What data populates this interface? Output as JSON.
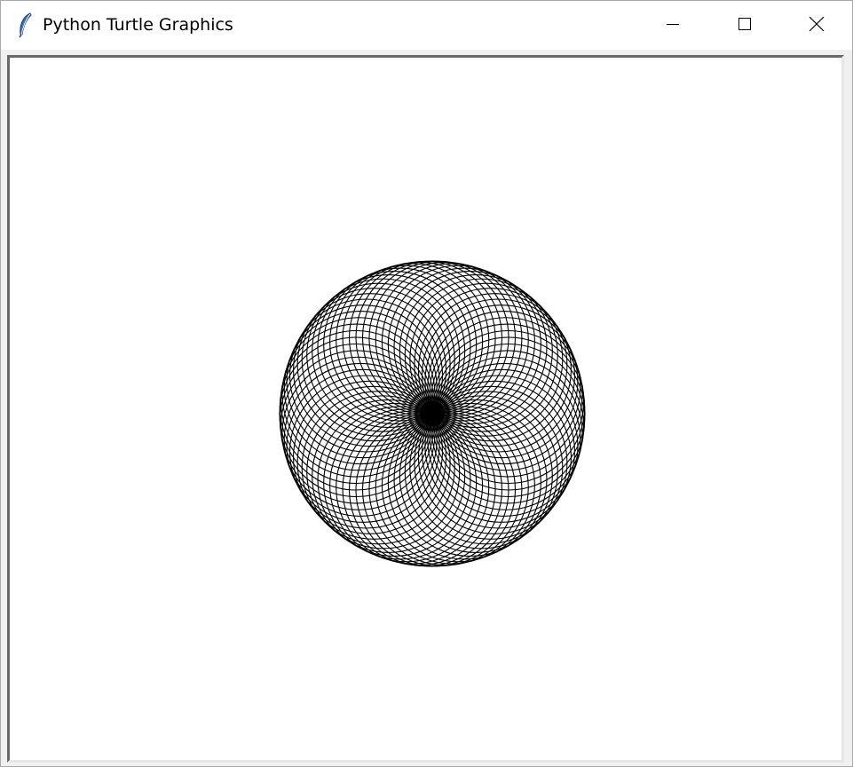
{
  "window": {
    "title": "Python Turtle Graphics",
    "app_icon": "feather-icon",
    "controls": {
      "minimize_icon": "minimize-icon",
      "maximize_icon": "maximize-icon",
      "close_icon": "close-icon"
    }
  },
  "canvas": {
    "background": "#ffffff",
    "pen_color": "#000000",
    "drawing": {
      "shape": "spirograph of overlapping circles",
      "circle_count": 72
    }
  }
}
